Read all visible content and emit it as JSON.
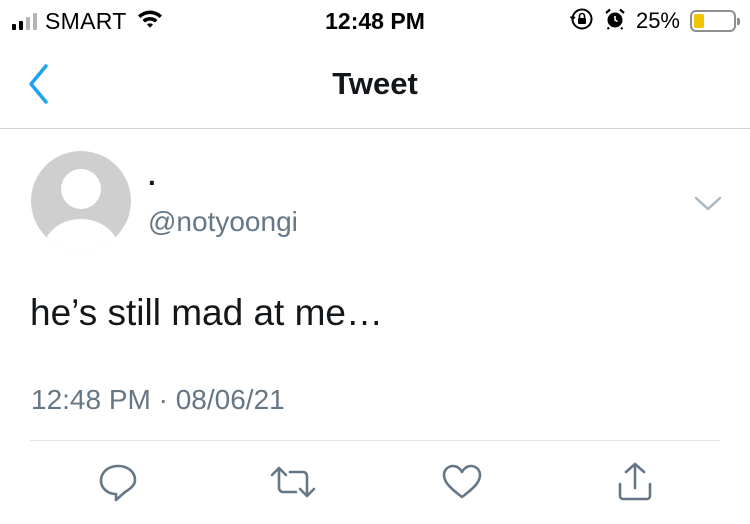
{
  "status_bar": {
    "carrier": "SMART",
    "time": "12:48 PM",
    "battery_percent_label": "25%",
    "battery_level": 0.25,
    "battery_color": "#f5c400",
    "icons": [
      "signal-bars-icon",
      "wifi-icon",
      "orientation-lock-icon",
      "alarm-icon",
      "battery-icon"
    ]
  },
  "nav": {
    "title": "Tweet",
    "back_icon": "chevron-left-icon",
    "accent_color": "#1da1f2"
  },
  "tweet": {
    "display_name": ".",
    "handle": "@notyoongi",
    "text": "he’s still mad at me…",
    "timestamp": "12:48 PM · 08/06/21",
    "avatar_icon": "default-profile-avatar",
    "menu_icon": "chevron-down-icon"
  },
  "actions": [
    {
      "name": "reply",
      "icon": "reply-icon"
    },
    {
      "name": "retweet",
      "icon": "retweet-icon"
    },
    {
      "name": "like",
      "icon": "heart-icon"
    },
    {
      "name": "share",
      "icon": "share-icon"
    }
  ]
}
